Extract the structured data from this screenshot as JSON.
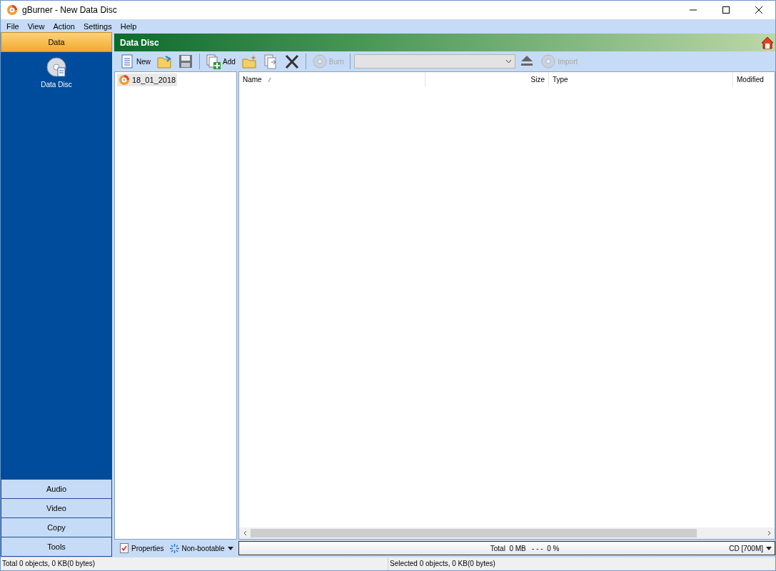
{
  "window": {
    "title": "gBurner - New Data Disc"
  },
  "menu": [
    "File",
    "View",
    "Action",
    "Settings",
    "Help"
  ],
  "sidebar": {
    "sections": [
      {
        "label": "Data",
        "selected": true,
        "items": [
          {
            "label": "Data Disc"
          }
        ]
      },
      {
        "label": "Audio",
        "selected": false
      },
      {
        "label": "Video",
        "selected": false
      },
      {
        "label": "Copy",
        "selected": false
      },
      {
        "label": "Tools",
        "selected": false
      }
    ]
  },
  "header": {
    "title": "Data Disc"
  },
  "toolbar": [
    {
      "kind": "button",
      "label": "New",
      "disabled": false
    },
    {
      "kind": "button",
      "disabled": false
    },
    {
      "kind": "button",
      "disabled": false
    },
    {
      "kind": "separator"
    },
    {
      "kind": "button",
      "label": "Add",
      "disabled": false
    },
    {
      "kind": "button",
      "disabled": false
    },
    {
      "kind": "button",
      "disabled": false
    },
    {
      "kind": "button",
      "disabled": false
    },
    {
      "kind": "separator"
    },
    {
      "kind": "button",
      "label": "Burn",
      "disabled": true
    },
    {
      "kind": "separator"
    },
    {
      "kind": "dropdown",
      "disabled": true
    },
    {
      "kind": "button",
      "disabled": false
    },
    {
      "kind": "button",
      "label": "Import",
      "disabled": true
    }
  ],
  "tree": [
    {
      "label": "18_01_2018",
      "selected": true
    }
  ],
  "table": {
    "columns": [
      {
        "label": "Name",
        "sorted": true
      },
      {
        "label": "Size",
        "sorted": false
      },
      {
        "label": "Type",
        "sorted": false
      },
      {
        "label": "Modified",
        "sorted": false
      }
    ]
  },
  "bottom": {
    "properties": "Properties",
    "boot": "Non-bootable",
    "total": "Total  0 MB   - - -  0 %",
    "media": "CD [700M]"
  },
  "status_bar": [
    "Total 0 objects, 0 KB(0 bytes)",
    "Selected 0 objects, 0 KB(0 bytes)"
  ]
}
